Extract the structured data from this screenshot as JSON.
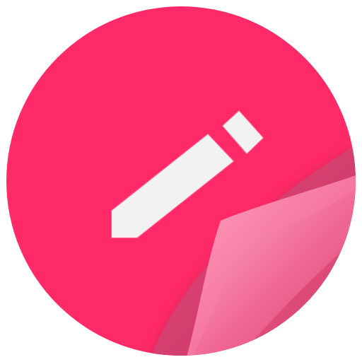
{
  "app_icon": {
    "icon": "notes-pencil-icon",
    "colors": {
      "background": "#ffffff",
      "disc": "#ff2a67",
      "disc_shadow": "#e91e5c",
      "pencil": "#f2f2f2",
      "page_curl_light": "#ff8fb1",
      "page_curl_mid": "#f2507f",
      "page_curl_dark": "#d93a6a"
    }
  }
}
